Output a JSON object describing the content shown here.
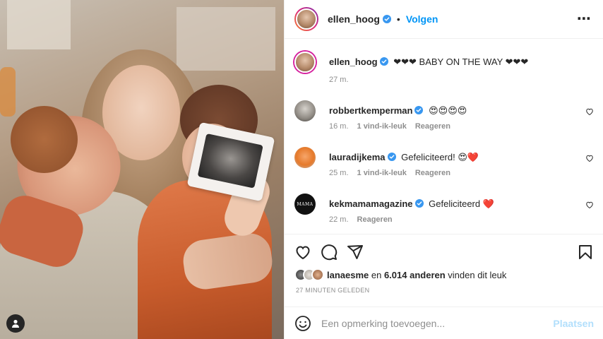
{
  "header": {
    "username": "ellen_hoog",
    "separator": "•",
    "follow_label": "Volgen",
    "more_label": "⋯"
  },
  "caption": {
    "username": "ellen_hoog",
    "text": "❤❤❤ BABY ON THE WAY ❤❤❤",
    "time": "27 m."
  },
  "comments": [
    {
      "username": "robbertkemperman",
      "text": "😍😍😍😍",
      "time": "16 m.",
      "likes": "1 vind-ik-leuk",
      "reply_label": "Reageren"
    },
    {
      "username": "lauradijkema",
      "text": "Gefeliciteerd! 😍❤️",
      "time": "25 m.",
      "likes": "1 vind-ik-leuk",
      "reply_label": "Reageren"
    },
    {
      "username": "kekmamamagazine",
      "avatar_text": "MAMA",
      "text": "Gefeliciteerd ❤️",
      "time": "22 m.",
      "reply_label": "Reageren"
    }
  ],
  "likes": {
    "first_user": "lanaesme",
    "middle": " en ",
    "count": "6.014 anderen",
    "suffix": " vinden dit leuk"
  },
  "timestamp": "27 MINUTEN GELEDEN",
  "add_comment": {
    "placeholder": "Een opmerking toevoegen...",
    "post_label": "Plaatsen"
  },
  "colors": {
    "accent": "#0095f6",
    "post_disabled": "#b2dffc",
    "muted": "#8e8e8e"
  },
  "icons": [
    "heart-icon",
    "comment-icon",
    "share-icon",
    "bookmark-icon",
    "emoji-icon",
    "verified-icon",
    "more-options-icon",
    "user-tag-icon"
  ]
}
